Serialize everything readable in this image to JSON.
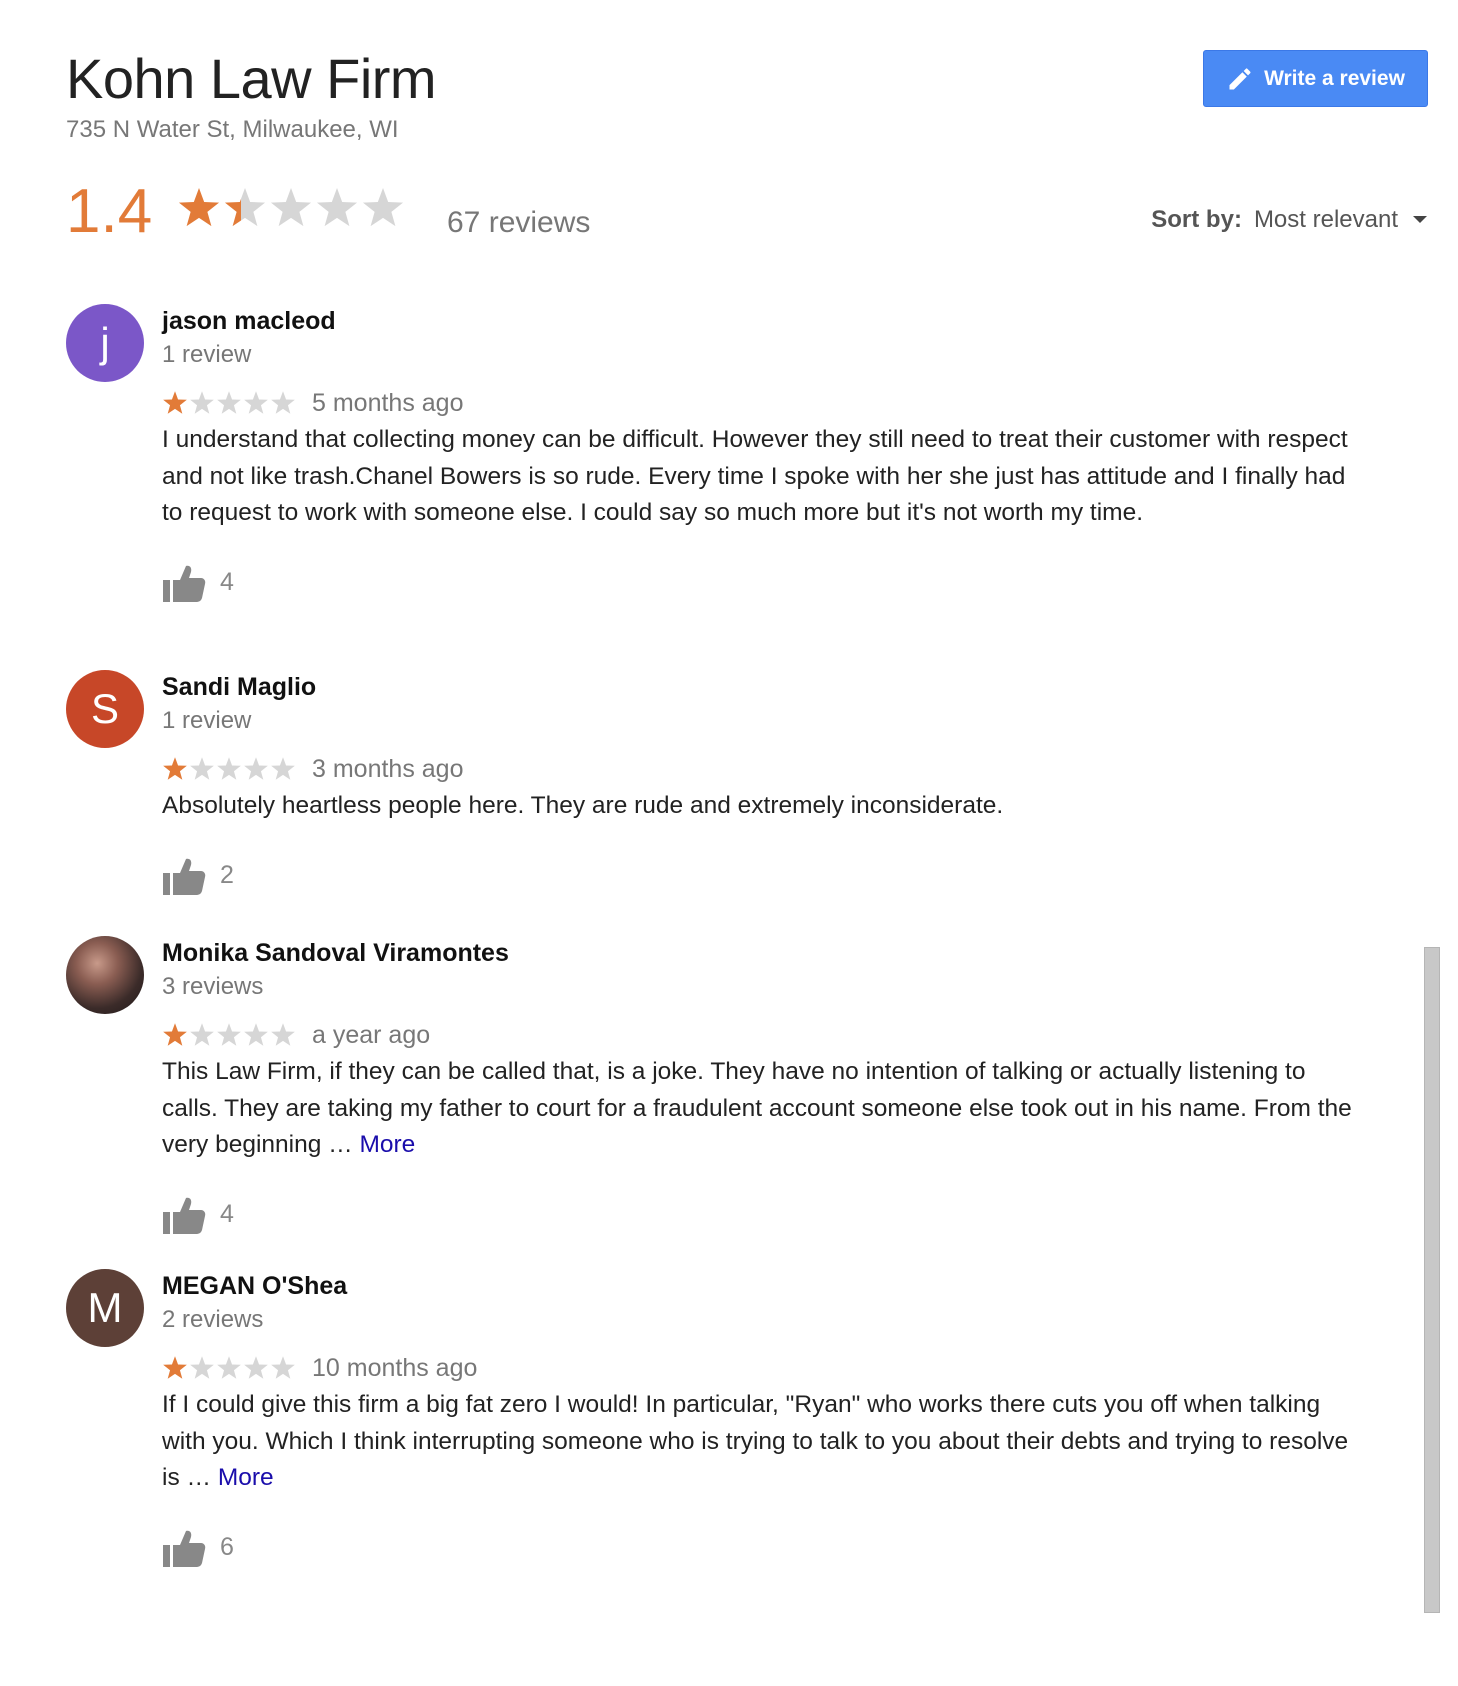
{
  "business": {
    "name": "Kohn Law Firm",
    "address": "735 N Water St, Milwaukee, WI",
    "rating": "1.4",
    "rating_value": 1.4,
    "reviews_count": "67 reviews"
  },
  "actions": {
    "write_review": "Write a review"
  },
  "sort": {
    "label": "Sort by:",
    "value": "Most relevant"
  },
  "colors": {
    "accent_star": "#e27b38",
    "empty_star": "#d6d6d6",
    "button": "#4a8af4",
    "link": "#1a0dab"
  },
  "reviews": [
    {
      "name": "jason macleod",
      "count": "1 review",
      "initial": "j",
      "avatar_color": "#7b57c8",
      "stars": 1,
      "date": "5 months ago",
      "text": "I understand that collecting money can be difficult. However they still need to treat their customer with respect and not like trash.Chanel Bowers is so rude. Every time I spoke with her she just has attitude and I finally had to request to work with someone else. I could say so much more but it's not worth my time.",
      "more": "",
      "likes": "4"
    },
    {
      "name": "Sandi Maglio",
      "count": "1 review",
      "initial": "S",
      "avatar_color": "#c74728",
      "stars": 1,
      "date": "3 months ago",
      "text": "Absolutely heartless people here. They are rude and extremely inconsiderate.",
      "more": "",
      "likes": "2"
    },
    {
      "name": "Monika Sandoval Viramontes",
      "count": "3 reviews",
      "initial": "",
      "avatar_color": "#5a4540",
      "stars": 1,
      "date": "a year ago",
      "text": "This Law Firm, if they can be called that, is a joke. They have no intention of talking or actually listening to calls. They are taking my father to court for a fraudulent account someone else took out in his name. From the very beginning … ",
      "more": "More",
      "likes": "4"
    },
    {
      "name": "MEGAN O'Shea",
      "count": "2 reviews",
      "initial": "M",
      "avatar_color": "#5d4037",
      "stars": 1,
      "date": "10 months ago",
      "text": "If I could give this firm a big fat zero I would! In particular, \"Ryan\" who works there cuts you off when talking with you. Which I think interrupting someone who is trying to talk to you about their debts and trying to resolve is … ",
      "more": "More",
      "likes": "6"
    }
  ]
}
